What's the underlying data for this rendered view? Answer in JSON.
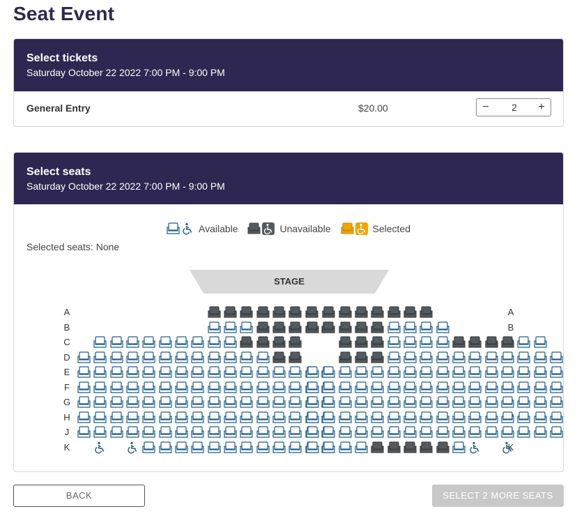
{
  "page": {
    "title": "Seat Event"
  },
  "tickets": {
    "title": "Select tickets",
    "date": "Saturday October 22 2022 7:00 PM - 9:00 PM",
    "item": {
      "name": "General Entry",
      "price": "$20.00",
      "quantity": "2",
      "minus": "−",
      "plus": "+"
    }
  },
  "seats": {
    "title": "Select seats",
    "date": "Saturday October 22 2022 7:00 PM - 9:00 PM",
    "legend": {
      "available": "Available",
      "unavailable": "Unavailable",
      "selected": "Selected"
    },
    "selected_label": "Selected seats:",
    "selected_value": "None",
    "stage": "STAGE",
    "colors": {
      "available": "#1d5c8a",
      "unavailable": "#555a5e",
      "selected": "#f0a500",
      "stage": "#d9d9d9"
    },
    "rows": [
      {
        "label": "A",
        "left": "........UUUUUUU.",
        "right": ".UUUUUUU........"
      },
      {
        "label": "B",
        "left": "........AAAUUUUU",
        "right": "UUUUUAAAA......."
      },
      {
        "label": "C",
        "left": ".AAAAAAAAAUUUU..",
        "right": "..UUUAAAAUUUUAA."
      },
      {
        "label": "D",
        "left": "AAAAAAAAAAAAUU..",
        "right": "..UUUAAAAAAAAAAA"
      },
      {
        "label": "E",
        "left": "AAAAAAAAAAAAAAAA",
        "right": "AAAAAAAAAAAAAAAA"
      },
      {
        "label": "F",
        "left": "AAAAAAAAAAAAAAAA",
        "right": "AAAAAAAAAAAAAAAA"
      },
      {
        "label": "G",
        "left": "AAAAAAAAAAAAAAAA",
        "right": "AAAAAAAAAAAAAAAA"
      },
      {
        "label": "H",
        "left": "AAAAAAAAAAAAAAAA",
        "right": "AAAAAAAAAAAAAAAA"
      },
      {
        "label": "J",
        "left": "AAAAAAAAAAAAAAAA",
        "right": "AAAAAAAAAAAAAAAA"
      },
      {
        "label": "K",
        "left": ".W.WAAAAAAAAAAAA",
        "right": "AAAAUUUUUAW.W..."
      }
    ]
  },
  "footer": {
    "back": "BACK",
    "select_more": "SELECT 2 MORE SEATS"
  }
}
